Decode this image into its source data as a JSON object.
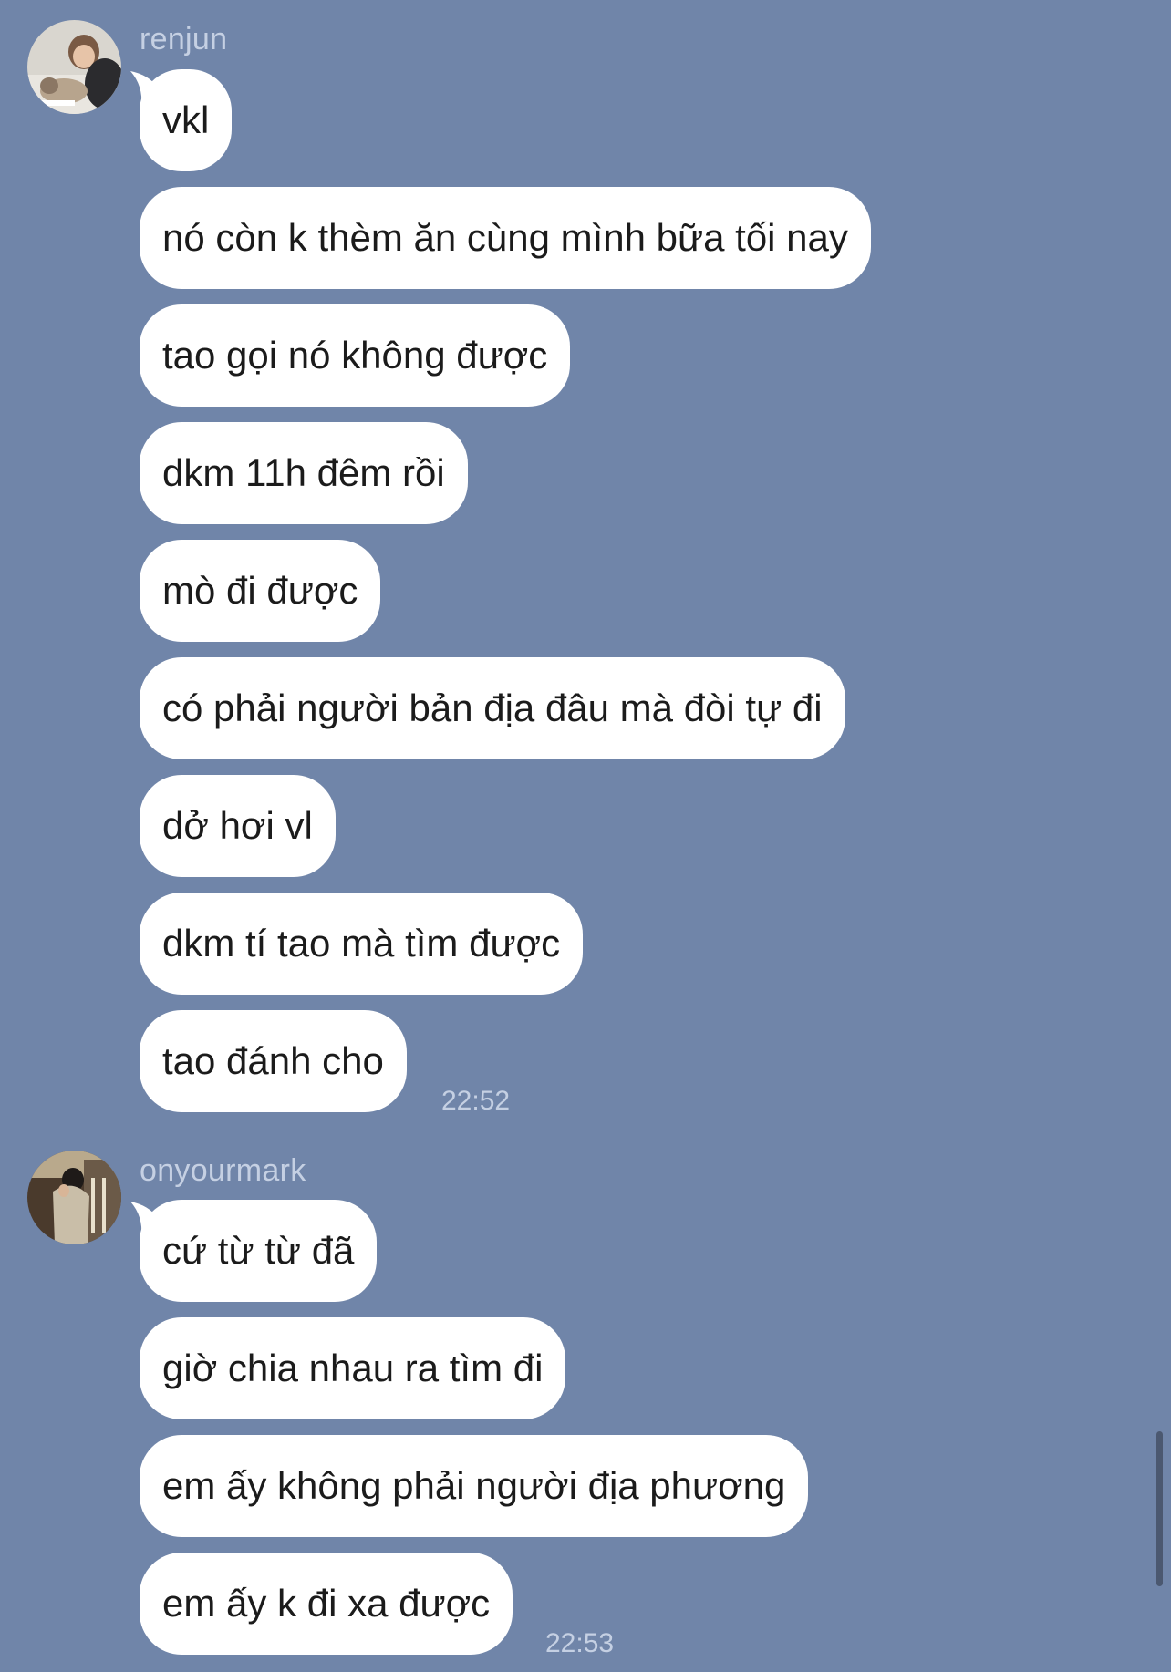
{
  "theme": {
    "background": "#7085a9",
    "bubble": "#ffffff",
    "meta_text": "#c5d0e3"
  },
  "groups": [
    {
      "sender": "renjun",
      "avatar_icon": "profile-photo-avatar",
      "messages": [
        "vkl",
        "nó còn k thèm ăn cùng mình bữa tối nay",
        "tao gọi nó không được",
        "dkm 11h đêm rồi",
        "mò đi được",
        "có phải người bản địa đâu mà đòi tự đi",
        "dở hơi vl",
        "dkm tí tao mà tìm được",
        "tao đánh cho"
      ],
      "time": "22:52"
    },
    {
      "sender": "onyourmark",
      "avatar_icon": "profile-photo-avatar",
      "messages": [
        "cứ từ từ đã",
        "giờ chia nhau ra tìm đi",
        "em ấy không phải người địa phương",
        "em ấy k đi xa được"
      ],
      "time": "22:53"
    }
  ]
}
